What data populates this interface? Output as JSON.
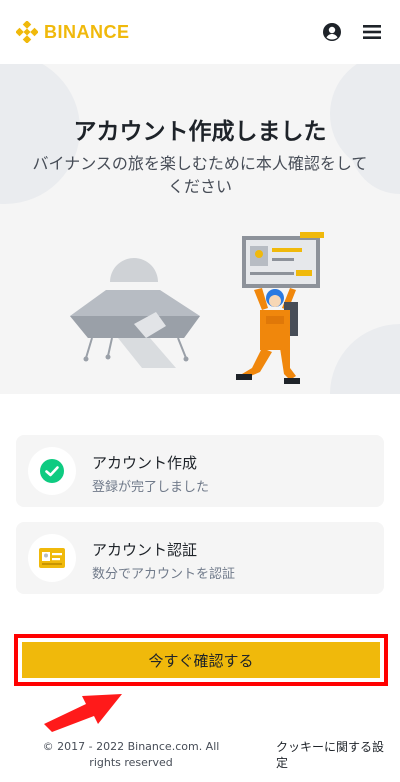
{
  "header": {
    "logo_text": "BINANCE",
    "user_icon": "user-circle-icon",
    "menu_icon": "hamburger-menu-icon"
  },
  "hero": {
    "title": "アカウント作成しました",
    "subtitle": "バイナンスの旅を楽しむために本人確認をしてください"
  },
  "steps": [
    {
      "title": "アカウント作成",
      "description": "登録が完了しました",
      "icon": "check-circle-icon",
      "status": "completed"
    },
    {
      "title": "アカウント認証",
      "description": "数分でアカウントを認証",
      "icon": "id-card-icon",
      "status": "pending"
    }
  ],
  "cta": {
    "label": "今すぐ確認する"
  },
  "footer": {
    "copyright": "© 2017 - 2022 Binance.com. All rights reserved",
    "cookie_link": "クッキーに関する設定"
  },
  "colors": {
    "brand": "#F0B90B",
    "success": "#0ECB81",
    "annotation": "#FF0000",
    "text_primary": "#1E2329",
    "text_secondary": "#707A8A"
  }
}
